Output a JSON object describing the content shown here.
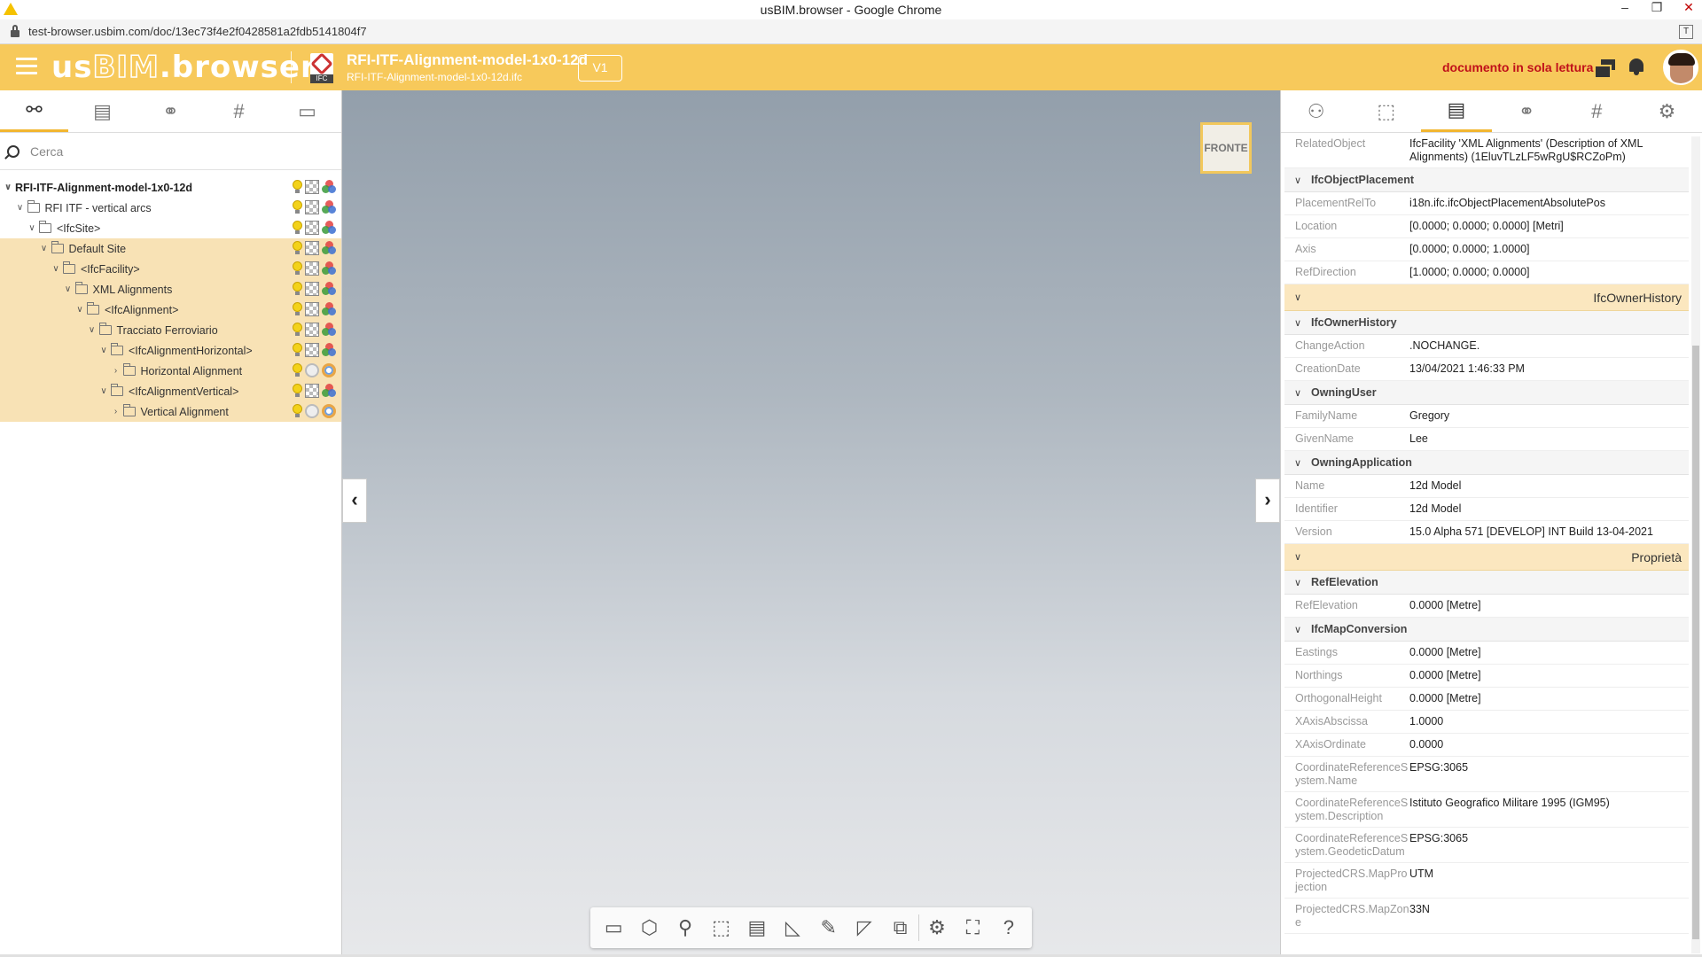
{
  "browser": {
    "window_title": "usBIM.browser - Google Chrome",
    "url": "test-browser.usbim.com/doc/13ec73f4e2f0428581a2fdb5141804f7",
    "controls": [
      "‒",
      "❐",
      "✕"
    ]
  },
  "header": {
    "logo_us": "us",
    "logo_bim": "BIM",
    "logo_rest": ".browser",
    "doc_title": "RFI-ITF-Alignment-model-1x0-12d",
    "doc_subtitle": "RFI-ITF-Alignment-model-1x0-12d.ifc",
    "ifc_label": "IFC",
    "version_label": "V1",
    "readonly_text": "documento in sola lettura",
    "accent_color": "#f7c95b",
    "readonly_color": "#c0101a"
  },
  "left_tabs": [
    {
      "icon": "hierarchy-icon",
      "glyph": "⚯",
      "active": true
    },
    {
      "icon": "document-icon",
      "glyph": "▤",
      "active": false
    },
    {
      "icon": "link-icon",
      "glyph": "⚭",
      "active": false
    },
    {
      "icon": "hash-icon",
      "glyph": "#",
      "active": false
    },
    {
      "icon": "layers-icon",
      "glyph": "▭",
      "active": false
    }
  ],
  "search": {
    "placeholder": "Cerca"
  },
  "tree": [
    {
      "label": "RFI-ITF-Alignment-model-1x0-12d",
      "depth": 0,
      "chev": "∨",
      "folder": false,
      "root": true,
      "hl": false,
      "ring": false
    },
    {
      "label": "RFI ITF - vertical arcs",
      "depth": 1,
      "chev": "∨",
      "folder": true,
      "root": false,
      "hl": false,
      "ring": false
    },
    {
      "label": "<IfcSite>",
      "depth": 2,
      "chev": "∨",
      "folder": true,
      "root": false,
      "hl": false,
      "ring": false
    },
    {
      "label": "Default Site",
      "depth": 3,
      "chev": "∨",
      "folder": true,
      "root": false,
      "hl": true,
      "ring": false
    },
    {
      "label": "<IfcFacility>",
      "depth": 4,
      "chev": "∨",
      "folder": true,
      "root": false,
      "hl": true,
      "ring": false
    },
    {
      "label": "XML Alignments",
      "depth": 5,
      "chev": "∨",
      "folder": true,
      "root": false,
      "hl": true,
      "ring": false
    },
    {
      "label": "<IfcAlignment>",
      "depth": 6,
      "chev": "∨",
      "folder": true,
      "root": false,
      "hl": true,
      "ring": false
    },
    {
      "label": "Tracciato Ferroviario",
      "depth": 7,
      "chev": "∨",
      "folder": true,
      "root": false,
      "hl": true,
      "ring": false
    },
    {
      "label": "<IfcAlignmentHorizontal>",
      "depth": 8,
      "chev": "∨",
      "folder": true,
      "root": false,
      "hl": true,
      "ring": false
    },
    {
      "label": "Horizontal Alignment",
      "depth": 9,
      "chev": "›",
      "folder": true,
      "root": false,
      "hl": true,
      "ring": true
    },
    {
      "label": "<IfcAlignmentVertical>",
      "depth": 8,
      "chev": "∨",
      "folder": true,
      "root": false,
      "hl": true,
      "ring": false
    },
    {
      "label": "Vertical Alignment",
      "depth": 9,
      "chev": "›",
      "folder": true,
      "root": false,
      "hl": true,
      "ring": true
    }
  ],
  "viewport": {
    "viewcube_label": "FRONTE",
    "nav_left": "‹",
    "nav_right": "›",
    "tools": [
      {
        "name": "camera-icon",
        "glyph": "▭"
      },
      {
        "name": "cube-icon",
        "glyph": "⬡"
      },
      {
        "name": "broadcast-icon",
        "glyph": "⚲"
      },
      {
        "name": "box-section-icon",
        "glyph": "⬚"
      },
      {
        "name": "document-pin-icon",
        "glyph": "▤"
      },
      {
        "name": "measure-icon",
        "glyph": "◺"
      },
      {
        "name": "brush-icon",
        "glyph": "✎"
      },
      {
        "name": "section-plane-icon",
        "glyph": "◸"
      },
      {
        "name": "compare-icon",
        "glyph": "⧉"
      },
      {
        "name": "settings-icon",
        "glyph": "⚙"
      },
      {
        "name": "fit-view-icon",
        "glyph": "⛶"
      },
      {
        "name": "help-icon",
        "glyph": "?"
      }
    ]
  },
  "right_tabs": [
    {
      "icon": "users-icon",
      "glyph": "⚇",
      "active": false
    },
    {
      "icon": "selection-icon",
      "glyph": "⬚",
      "active": false
    },
    {
      "icon": "properties-icon",
      "glyph": "▤",
      "active": true
    },
    {
      "icon": "link-icon",
      "glyph": "⚭",
      "active": false
    },
    {
      "icon": "hash-icon",
      "glyph": "#",
      "active": false
    },
    {
      "icon": "gear-icon",
      "glyph": "⚙",
      "active": false
    }
  ],
  "properties": [
    {
      "type": "row",
      "k": "RelatedObject",
      "v": "IfcFacility 'XML Alignments' (Description of XML Alignments) (1EluvTLzLF5wRgU$RCZoPm)"
    },
    {
      "type": "group",
      "t": "IfcObjectPlacement"
    },
    {
      "type": "row",
      "k": "PlacementRelTo",
      "v": "i18n.ifc.ifcObjectPlacementAbsolutePos"
    },
    {
      "type": "row",
      "k": "Location",
      "v": "[0.0000; 0.0000; 0.0000] [Metri]"
    },
    {
      "type": "row",
      "k": "Axis",
      "v": "[0.0000; 0.0000; 1.0000]"
    },
    {
      "type": "row",
      "k": "RefDirection",
      "v": "[1.0000; 0.0000; 0.0000]"
    },
    {
      "type": "section",
      "t": "IfcOwnerHistory"
    },
    {
      "type": "group",
      "t": "IfcOwnerHistory"
    },
    {
      "type": "row",
      "k": "ChangeAction",
      "v": ".NOCHANGE."
    },
    {
      "type": "row",
      "k": "CreationDate",
      "v": "13/04/2021 1:46:33 PM"
    },
    {
      "type": "group",
      "t": "OwningUser"
    },
    {
      "type": "row",
      "k": "FamilyName",
      "v": "Gregory"
    },
    {
      "type": "row",
      "k": "GivenName",
      "v": "Lee"
    },
    {
      "type": "group",
      "t": "OwningApplication"
    },
    {
      "type": "row",
      "k": "Name",
      "v": "12d Model"
    },
    {
      "type": "row",
      "k": "Identifier",
      "v": "12d Model"
    },
    {
      "type": "row",
      "k": "Version",
      "v": "15.0 Alpha 571 [DEVELOP] INT Build 13-04-2021"
    },
    {
      "type": "section",
      "t": "Proprietà"
    },
    {
      "type": "group",
      "t": "RefElevation"
    },
    {
      "type": "row",
      "k": "RefElevation",
      "v": "0.0000 [Metre]"
    },
    {
      "type": "group",
      "t": "IfcMapConversion"
    },
    {
      "type": "row",
      "k": "Eastings",
      "v": "0.0000 [Metre]"
    },
    {
      "type": "row",
      "k": "Northings",
      "v": "0.0000 [Metre]"
    },
    {
      "type": "row",
      "k": "OrthogonalHeight",
      "v": "0.0000 [Metre]"
    },
    {
      "type": "row",
      "k": "XAxisAbscissa",
      "v": "1.0000"
    },
    {
      "type": "row",
      "k": "XAxisOrdinate",
      "v": "0.0000"
    },
    {
      "type": "row",
      "k": "CoordinateReferenceSystem.Name",
      "v": "EPSG:3065"
    },
    {
      "type": "row",
      "k": "CoordinateReferenceSystem.Description",
      "v": "Istituto Geografico Militare 1995 (IGM95)"
    },
    {
      "type": "row",
      "k": "CoordinateReferenceSystem.GeodeticDatum",
      "v": "EPSG:3065"
    },
    {
      "type": "row",
      "k": "ProjectedCRS.MapProjection",
      "v": "UTM"
    },
    {
      "type": "row",
      "k": "ProjectedCRS.MapZone",
      "v": "33N"
    }
  ]
}
